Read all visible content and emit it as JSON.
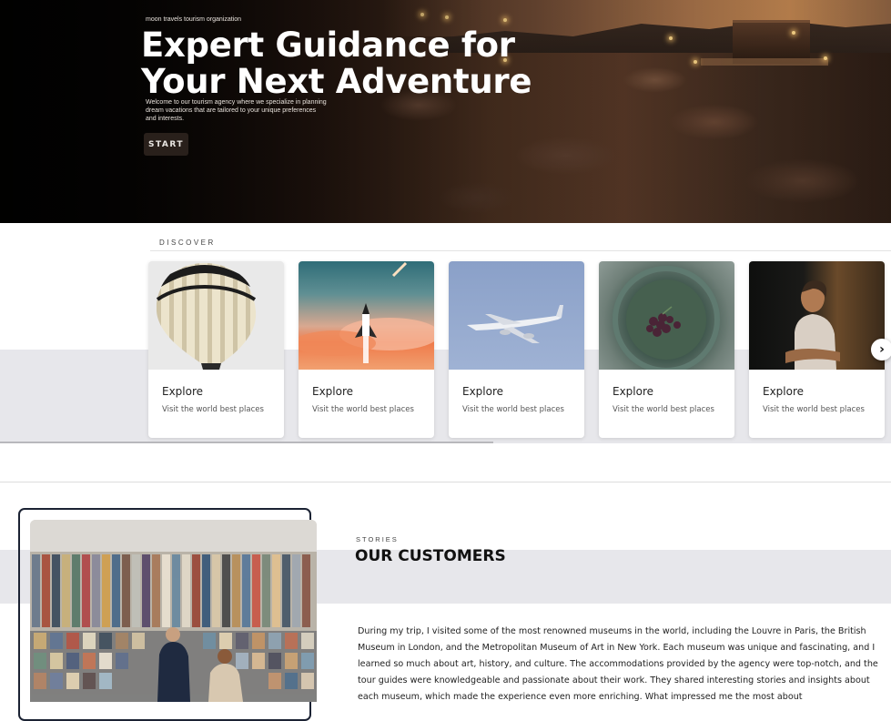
{
  "hero": {
    "org": "moon travels tourism organization",
    "title_line1": "Expert Guidance for",
    "title_line2": "Your Next Adventure",
    "description": "Welcome to our tourism agency where we specialize in planning dream vacations that are tailored to your unique preferences and interests.",
    "button_label": "START"
  },
  "discover": {
    "label": "DISCOVER",
    "cards": [
      {
        "title": "Explore",
        "subtitle": "Visit the world best places",
        "image": "hot-air-balloon"
      },
      {
        "title": "Explore",
        "subtitle": "Visit the world best places",
        "image": "space-shuttle-launch"
      },
      {
        "title": "Explore",
        "subtitle": "Visit the world best places",
        "image": "airplane-in-sky"
      },
      {
        "title": "Explore",
        "subtitle": "Visit the world best places",
        "image": "grapes-on-plate"
      },
      {
        "title": "Explore",
        "subtitle": "Visit the world best places",
        "image": "woman-in-shadow"
      }
    ],
    "next_icon": "chevron-right-icon"
  },
  "stories": {
    "label": "STORIES",
    "title": "OUR CUSTOMERS",
    "image": "postcard-wall",
    "text": "During my trip, I visited some of the most renowned museums in the world, including the Louvre in Paris, the British Museum in London, and the Metropolitan Museum of Art in New York. Each museum was unique and fascinating, and I learned so much about art, history, and culture. The accommodations provided by the agency were top-notch, and the tour guides were knowledgeable and passionate about their work. They shared interesting stories and insights about each museum, which made the experience even more enriching. What impressed me the most about"
  },
  "colors": {
    "band_gray": "#e7e7eb",
    "frame_navy": "#1b2233",
    "hero_button": "#2d231e"
  }
}
